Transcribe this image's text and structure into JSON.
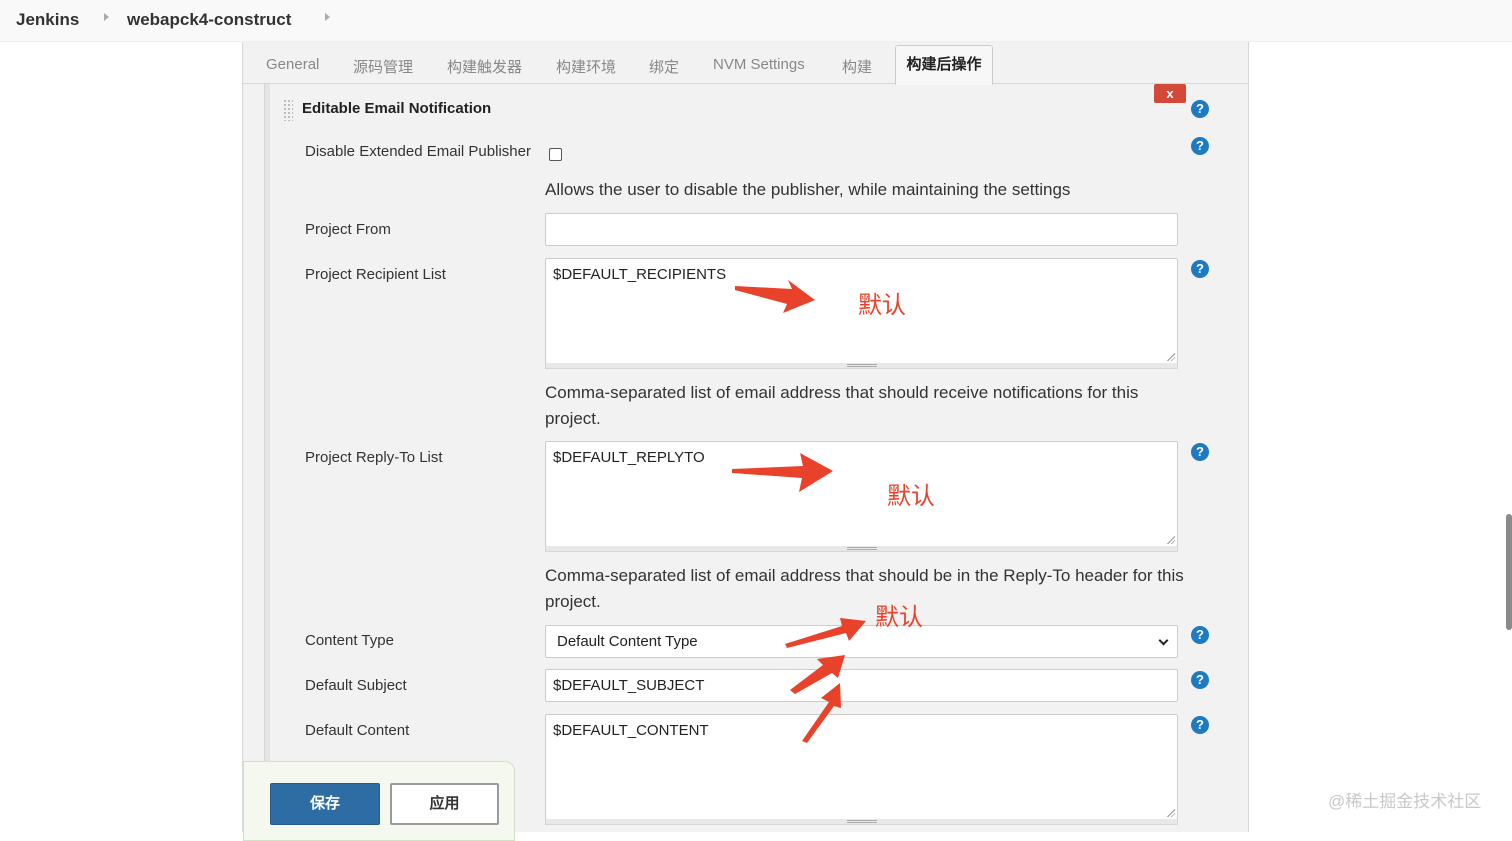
{
  "breadcrumb": {
    "root": "Jenkins",
    "job": "webapck4-construct"
  },
  "tabs": {
    "general": "General",
    "scm": "源码管理",
    "triggers": "构建触发器",
    "env": "构建环境",
    "bindings": "绑定",
    "nvm": "NVM Settings",
    "build": "构建",
    "post_build": "构建后操作"
  },
  "section": {
    "title": "Editable Email Notification",
    "delete_label": "x"
  },
  "fields": {
    "disable_label": "Disable Extended Email Publisher",
    "disable_desc": "Allows the user to disable the publisher, while maintaining the settings",
    "project_from_label": "Project From",
    "project_from_value": "",
    "recipients_label": "Project Recipient List",
    "recipients_value": "$DEFAULT_RECIPIENTS",
    "recipients_desc": "Comma-separated list of email address that should receive notifications for this project.",
    "replyto_label": "Project Reply-To List",
    "replyto_value": "$DEFAULT_REPLYTO",
    "replyto_desc": "Comma-separated list of email address that should be in the Reply-To header for this project.",
    "content_type_label": "Content Type",
    "content_type_value": "Default Content Type",
    "subject_label": "Default Subject",
    "subject_value": "$DEFAULT_SUBJECT",
    "content_label": "Default Content",
    "content_value": "$DEFAULT_CONTENT"
  },
  "help_glyph": "?",
  "buttons": {
    "save": "保存",
    "apply": "应用"
  },
  "annotations": {
    "default_1": "默认",
    "default_2": "默认",
    "default_3": "默认"
  },
  "watermark": "@稀土掘金技术社区",
  "colors": {
    "annotation": "#e8432a",
    "save_button": "#2e6da4",
    "help_icon": "#1f7bc1",
    "delete_button": "#d24939"
  }
}
